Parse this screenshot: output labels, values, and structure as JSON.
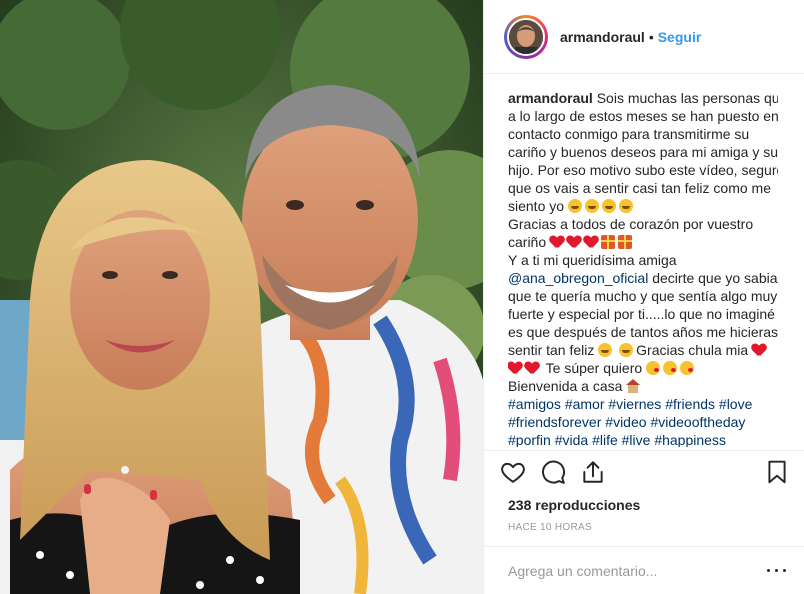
{
  "header": {
    "username": "armandoraul",
    "separator": "•",
    "follow_label": "Seguir"
  },
  "caption": {
    "username": "armandoraul",
    "lines": [
      "Sois muchas las personas que",
      "a lo largo de estos meses se han puesto en",
      "contacto conmigo para transmitirme su",
      "cariño y buenos deseos para mi amiga y su",
      "hijo. Por eso motivo subo este vídeo, seguro",
      "que os vais a sentir casi tan feliz como me",
      "siento yo",
      "Gracias a todos de corazón por vuestro",
      "cariño",
      "Y a ti mi queridísima amiga",
      "@ana_obregon_oficial",
      " decirte que yo sabia",
      "que te quería mucho y que sentía algo muy",
      "fuerte y especial por ti.....lo que no imaginé",
      "es que después de tantos años me hicieras",
      "sentir tan feliz",
      "Gracias chula mia",
      "Te súper quiero",
      "Bienvenida a casa"
    ],
    "hashtags_1": [
      "#amigos",
      "#amor",
      "#viernes",
      "#friends",
      "#love"
    ],
    "hashtags_2": [
      "#friendsforever",
      "#video",
      "#videooftheday"
    ],
    "hashtags_3": [
      "#porfin",
      "#vida",
      "#life",
      "#live",
      "#happiness"
    ]
  },
  "actions": {
    "like_icon": "heart-outline-icon",
    "comment_icon": "comment-bubble-icon",
    "share_icon": "share-upload-icon",
    "save_icon": "bookmark-icon"
  },
  "stats": {
    "views": "238 reproducciones",
    "time": "HACE 10 HORAS"
  },
  "comment": {
    "placeholder": "Agrega un comentario..."
  },
  "colors": {
    "link": "#003569",
    "follow": "#3897f0",
    "muted": "#999999"
  }
}
